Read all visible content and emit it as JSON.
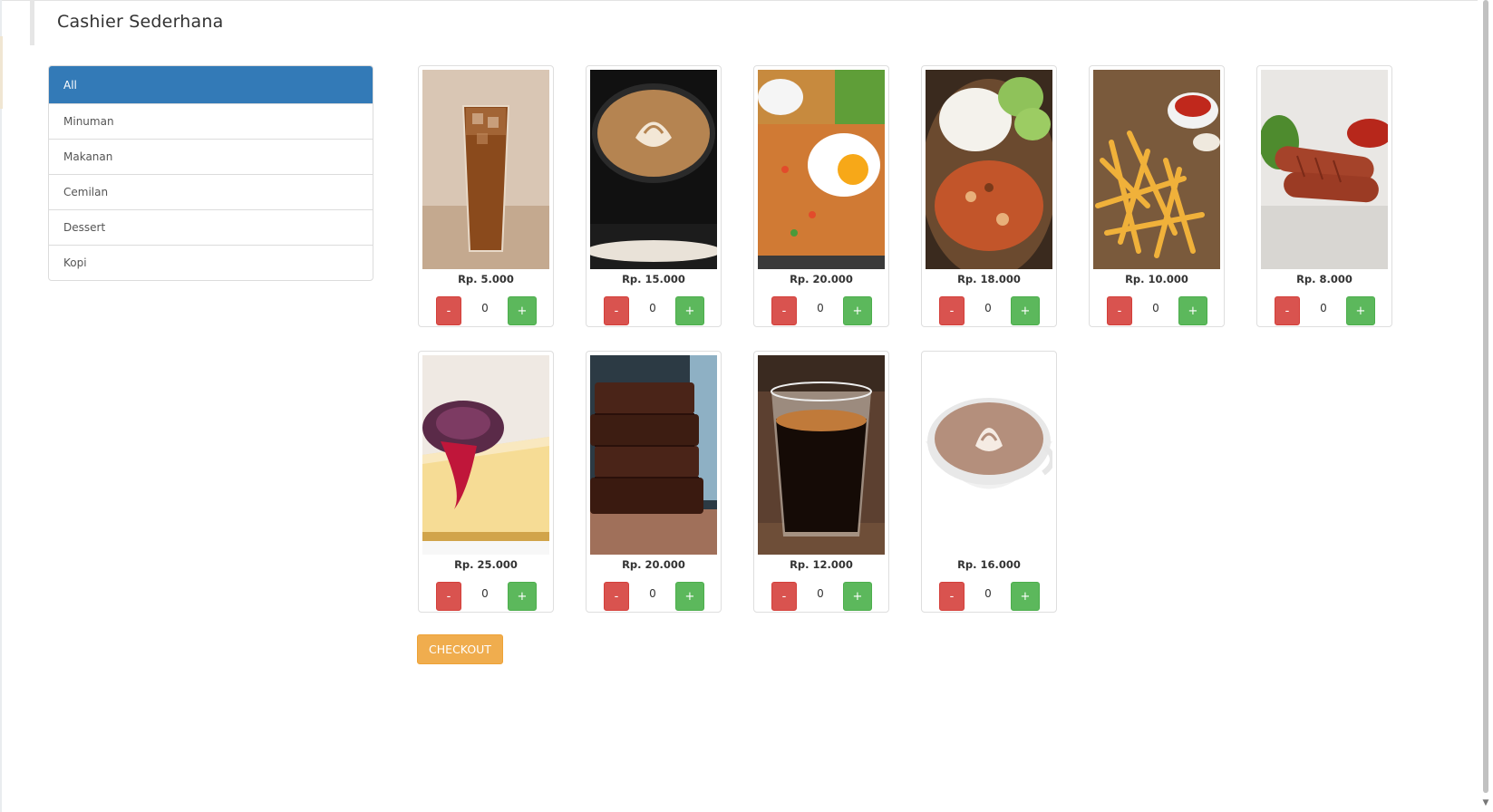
{
  "app": {
    "title": "Cashier Sederhana"
  },
  "categories": [
    {
      "label": "All",
      "active": true
    },
    {
      "label": "Minuman",
      "active": false
    },
    {
      "label": "Makanan",
      "active": false
    },
    {
      "label": "Cemilan",
      "active": false
    },
    {
      "label": "Dessert",
      "active": false
    },
    {
      "label": "Kopi",
      "active": false
    }
  ],
  "products": [
    {
      "image": "iced-tea-glass",
      "price": "Rp. 5.000",
      "qty": "0",
      "minus": "-",
      "plus": "+"
    },
    {
      "image": "latte-art-black-cup",
      "price": "Rp. 15.000",
      "qty": "0",
      "minus": "-",
      "plus": "+"
    },
    {
      "image": "fried-rice-egg",
      "price": "Rp. 20.000",
      "qty": "0",
      "minus": "-",
      "plus": "+"
    },
    {
      "image": "chicken-rice-plate",
      "price": "Rp. 18.000",
      "qty": "0",
      "minus": "-",
      "plus": "+"
    },
    {
      "image": "french-fries",
      "price": "Rp. 10.000",
      "qty": "0",
      "minus": "-",
      "plus": "+"
    },
    {
      "image": "sausages-ketchup",
      "price": "Rp. 8.000",
      "qty": "0",
      "minus": "-",
      "plus": "+"
    },
    {
      "image": "cheesecake-berry",
      "price": "Rp. 25.000",
      "qty": "0",
      "minus": "-",
      "plus": "+"
    },
    {
      "image": "brownies-stack",
      "price": "Rp. 20.000",
      "qty": "0",
      "minus": "-",
      "plus": "+"
    },
    {
      "image": "espresso-glass",
      "price": "Rp. 12.000",
      "qty": "0",
      "minus": "-",
      "plus": "+"
    },
    {
      "image": "cappuccino-white-cup",
      "price": "Rp. 16.000",
      "qty": "0",
      "minus": "-",
      "plus": "+"
    }
  ],
  "checkout": {
    "label": "CHECKOUT"
  },
  "colors": {
    "active_category": "#337ab7",
    "minus_button": "#d9534f",
    "plus_button": "#5cb85c",
    "checkout_button": "#f0ad4e"
  }
}
